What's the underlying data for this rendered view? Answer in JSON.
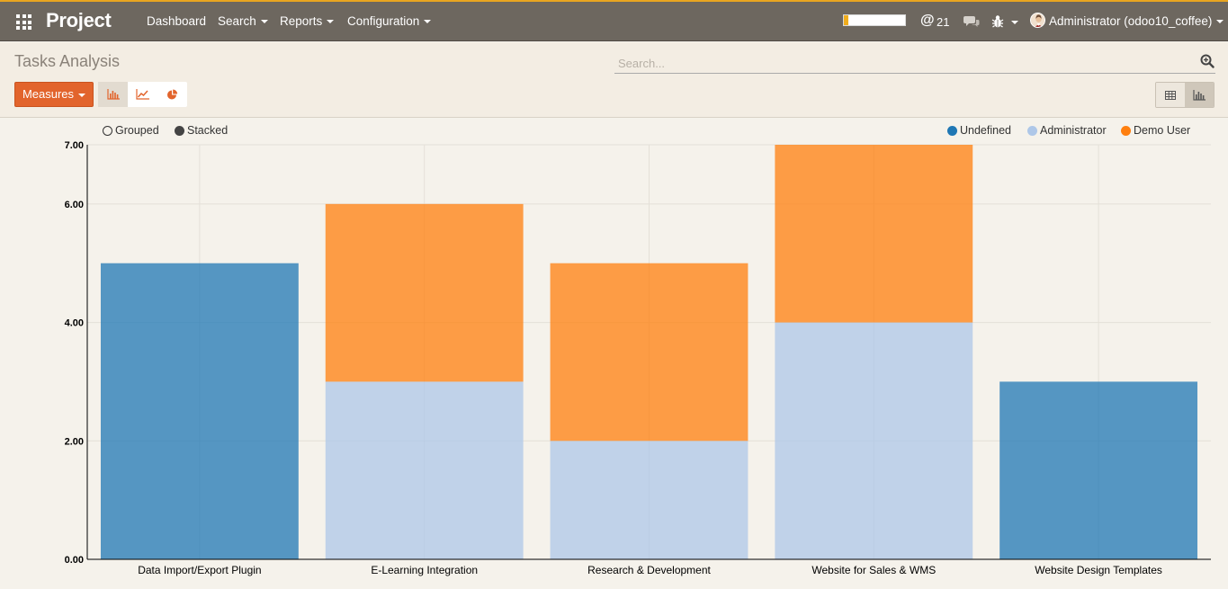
{
  "navbar": {
    "brand": "Project",
    "menus": [
      "Dashboard",
      "Search",
      "Reports",
      "Configuration"
    ],
    "progress_pct": 7,
    "message_count": "21",
    "user": "Administrator (odoo10_coffee)"
  },
  "control_panel": {
    "title": "Tasks Analysis",
    "search_placeholder": "Search...",
    "measures_label": "Measures"
  },
  "chart_data": {
    "type": "bar",
    "stacked": true,
    "modes": [
      "Grouped",
      "Stacked"
    ],
    "active_mode": "Stacked",
    "categories": [
      "Data Import/Export Plugin",
      "E-Learning Integration",
      "Research & Development",
      "Website for Sales & WMS",
      "Website Design Templates"
    ],
    "series": [
      {
        "name": "Undefined",
        "color": "#1f77b4",
        "values": [
          5,
          0,
          0,
          0,
          3
        ]
      },
      {
        "name": "Administrator",
        "color": "#aec7e8",
        "values": [
          0,
          3,
          2,
          4,
          0
        ]
      },
      {
        "name": "Demo User",
        "color": "#ff7f0e",
        "values": [
          0,
          3,
          3,
          3,
          0
        ]
      }
    ],
    "ylim": [
      0,
      7
    ],
    "yticks": [
      "0.00",
      "2.00",
      "4.00",
      "6.00",
      "7.00"
    ],
    "legend_position": "top-right",
    "grid": true
  }
}
